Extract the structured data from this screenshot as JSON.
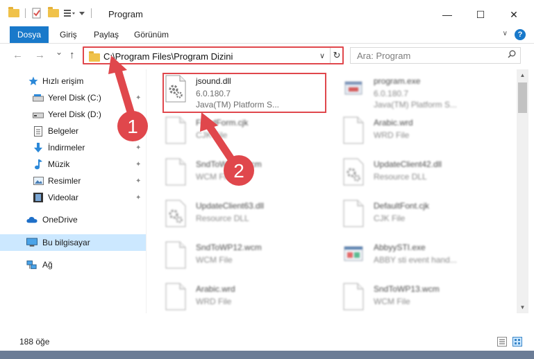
{
  "window": {
    "title": "Program",
    "controls": {
      "minimize": "—",
      "maximize": "☐",
      "close": "✕"
    }
  },
  "ribbon": {
    "file_tab": "Dosya",
    "tabs": [
      "Giriş",
      "Paylaş",
      "Görünüm"
    ]
  },
  "nav": {
    "back": "←",
    "forward": "→",
    "recent": "⌄",
    "up": "↑",
    "address": "C:\\Program Files\\Program Dizini",
    "search_placeholder": "Ara: Program"
  },
  "sidebar": {
    "items": [
      {
        "label": "Hızlı erişim",
        "icon": "star-icon",
        "pinned": false
      },
      {
        "label": "Yerel Disk (C:)",
        "icon": "drive-icon",
        "pinned": true
      },
      {
        "label": "Yerel Disk (D:)",
        "icon": "drive-icon",
        "pinned": true
      },
      {
        "label": "Belgeler",
        "icon": "document-icon",
        "pinned": true
      },
      {
        "label": "İndirmeler",
        "icon": "download-icon",
        "pinned": true
      },
      {
        "label": "Müzik",
        "icon": "music-icon",
        "pinned": true
      },
      {
        "label": "Resimler",
        "icon": "pictures-icon",
        "pinned": true
      },
      {
        "label": "Videolar",
        "icon": "video-icon",
        "pinned": true
      },
      {
        "label": "OneDrive",
        "icon": "cloud-icon",
        "pinned": false
      },
      {
        "label": "Bu bilgisayar",
        "icon": "computer-icon",
        "pinned": false,
        "selected": true
      },
      {
        "label": "Ağ",
        "icon": "network-icon",
        "pinned": false
      }
    ]
  },
  "files": [
    {
      "name": "jsound.dll",
      "line2": "6.0.180.7",
      "line3": "Java(TM) Platform S...",
      "icon": "dll-gear-icon",
      "highlighted": true
    },
    {
      "name": "program.exe",
      "line2": "6.0.180.7",
      "line3": "Java(TM) Platform S...",
      "icon": "exe-icon"
    },
    {
      "name": "FixedForm.cjk",
      "line2": "CJK File",
      "line3": "",
      "icon": "blank-file-icon"
    },
    {
      "name": "Arabic.wrd",
      "line2": "WRD File",
      "line3": "",
      "icon": "blank-file-icon"
    },
    {
      "name": "SndToWP15.wcm",
      "line2": "WCM File",
      "line3": "",
      "icon": "blank-file-icon"
    },
    {
      "name": "UpdateClient42.dll",
      "line2": "Resource DLL",
      "line3": "",
      "icon": "dll-gear-icon"
    },
    {
      "name": "UpdateClient63.dll",
      "line2": "Resource DLL",
      "line3": "",
      "icon": "dll-gear-icon"
    },
    {
      "name": "DefaultFont.cjk",
      "line2": "CJK File",
      "line3": "",
      "icon": "blank-file-icon"
    },
    {
      "name": "SndToWP12.wcm",
      "line2": "WCM File",
      "line3": "",
      "icon": "blank-file-icon"
    },
    {
      "name": "AbbyySTI.exe",
      "line2": "ABBY sti event hand...",
      "line3": "",
      "icon": "exe-icon"
    },
    {
      "name": "Arabic.wrd",
      "line2": "WRD File",
      "line3": "",
      "icon": "blank-file-icon"
    },
    {
      "name": "SndToWP13.wcm",
      "line2": "WCM File",
      "line3": "",
      "icon": "blank-file-icon"
    }
  ],
  "status": {
    "count": "188 öğe"
  },
  "annotations": {
    "step1": "1",
    "step2": "2"
  },
  "colors": {
    "accent": "#1979ca",
    "highlight": "#e0474c",
    "selected": "#cce8ff"
  }
}
